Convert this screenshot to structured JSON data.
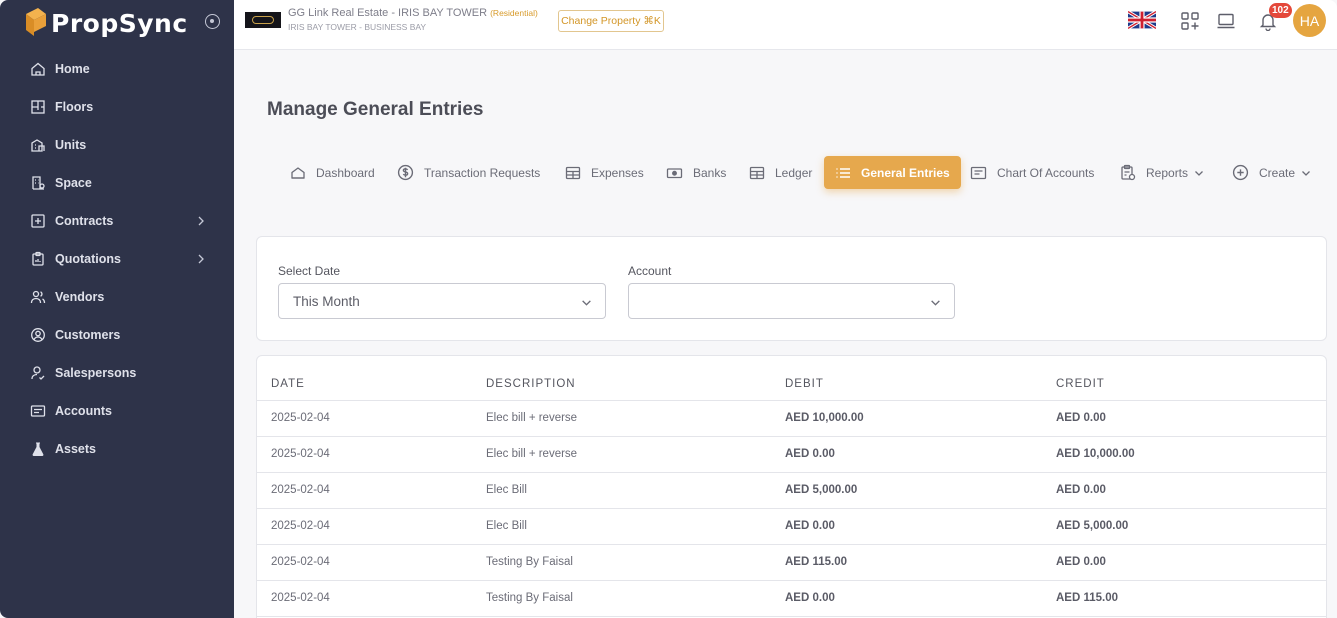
{
  "brand": {
    "name": "PropSync"
  },
  "sidebar": {
    "items": [
      {
        "label": "Home",
        "icon": "home-icon",
        "has_submenu": false
      },
      {
        "label": "Floors",
        "icon": "floors-icon",
        "has_submenu": false
      },
      {
        "label": "Units",
        "icon": "units-icon",
        "has_submenu": false
      },
      {
        "label": "Space",
        "icon": "space-icon",
        "has_submenu": false
      },
      {
        "label": "Contracts",
        "icon": "contracts-icon",
        "has_submenu": true
      },
      {
        "label": "Quotations",
        "icon": "quotations-icon",
        "has_submenu": true
      },
      {
        "label": "Vendors",
        "icon": "vendors-icon",
        "has_submenu": false
      },
      {
        "label": "Customers",
        "icon": "customers-icon",
        "has_submenu": false
      },
      {
        "label": "Salespersons",
        "icon": "salespersons-icon",
        "has_submenu": false
      },
      {
        "label": "Accounts",
        "icon": "accounts-icon",
        "has_submenu": false
      },
      {
        "label": "Assets",
        "icon": "assets-icon",
        "has_submenu": false
      }
    ]
  },
  "topbar": {
    "property_name": "GG Link Real Estate - IRIS BAY TOWER",
    "property_type": "(Residential)",
    "property_location": "IRIS BAY TOWER - BUSINESS BAY",
    "change_property": "Change Property ⌘K",
    "notification_count": "102",
    "avatar_initials": "HA",
    "language_flag": "uk-flag-icon"
  },
  "page": {
    "title": "Manage General Entries"
  },
  "tabs": [
    {
      "label": "Dashboard",
      "icon": "dashboard-icon",
      "active": false
    },
    {
      "label": "Transaction Requests",
      "icon": "dollar-icon",
      "active": false
    },
    {
      "label": "Expenses",
      "icon": "table-icon",
      "active": false
    },
    {
      "label": "Banks",
      "icon": "banknote-icon",
      "active": false
    },
    {
      "label": "Ledger",
      "icon": "table-icon",
      "active": false
    },
    {
      "label": "General Entries",
      "icon": "list-icon",
      "active": true
    },
    {
      "label": "Chart Of Accounts",
      "icon": "chart-icon",
      "active": false
    },
    {
      "label": "Reports",
      "icon": "clipboard-icon",
      "active": false,
      "dropdown": true
    },
    {
      "label": "Create",
      "icon": "plus-circle-icon",
      "active": false,
      "dropdown": true
    }
  ],
  "filters": {
    "date_label": "Select Date",
    "date_value": "This Month",
    "account_label": "Account",
    "account_value": ""
  },
  "table": {
    "columns": [
      "DATE",
      "DESCRIPTION",
      "DEBIT",
      "CREDIT"
    ],
    "rows": [
      {
        "date": "2025-02-04",
        "description": "Elec bill + reverse",
        "debit": "AED 10,000.00",
        "credit": "AED 0.00"
      },
      {
        "date": "2025-02-04",
        "description": "Elec bill + reverse",
        "debit": "AED 0.00",
        "credit": "AED 10,000.00"
      },
      {
        "date": "2025-02-04",
        "description": "Elec Bill",
        "debit": "AED 5,000.00",
        "credit": "AED 0.00"
      },
      {
        "date": "2025-02-04",
        "description": "Elec Bill",
        "debit": "AED 0.00",
        "credit": "AED 5,000.00"
      },
      {
        "date": "2025-02-04",
        "description": "Testing By Faisal",
        "debit": "AED 115.00",
        "credit": "AED 0.00"
      },
      {
        "date": "2025-02-04",
        "description": "Testing By Faisal",
        "debit": "AED 0.00",
        "credit": "AED 115.00"
      }
    ]
  },
  "colors": {
    "sidebar_bg": "#2e3349",
    "accent": "#e6a84d",
    "badge": "#e4483a"
  }
}
